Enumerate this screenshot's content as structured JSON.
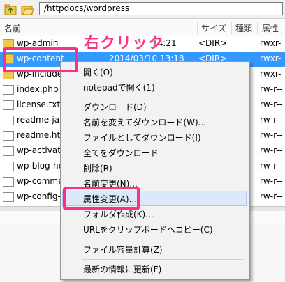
{
  "address_bar": {
    "path": "/httpdocs/wordpress"
  },
  "columns": {
    "name": "名前",
    "size": "サイズ",
    "type": "種類",
    "attr": "属性"
  },
  "rows": [
    {
      "name": "wp-admin",
      "date": "14:21",
      "size": "<DIR>",
      "attr": "rwxr-",
      "kind": "folder"
    },
    {
      "name": "wp-content",
      "date": "2014/03/10 13:18",
      "size": "<DIR>",
      "attr": "rwxr-",
      "kind": "folder",
      "selected": true
    },
    {
      "name": "wp-include",
      "date": "",
      "size": "",
      "attr": "rwxr-",
      "kind": "folder"
    },
    {
      "name": "index.php",
      "date": "",
      "size": "",
      "attr": "rw-r--",
      "kind": "file"
    },
    {
      "name": "license.txt",
      "date": "",
      "size": "",
      "attr": "rw-r--",
      "kind": "file"
    },
    {
      "name": "readme-ja",
      "date": "",
      "size": "",
      "attr": "rw-r--",
      "kind": "file"
    },
    {
      "name": "readme.ht",
      "date": "",
      "size": "",
      "attr": "rw-r--",
      "kind": "file"
    },
    {
      "name": "wp-activat",
      "date": "",
      "size": "",
      "attr": "rw-r--",
      "kind": "file"
    },
    {
      "name": "wp-blog-he",
      "date": "",
      "size": "",
      "attr": "rw-r--",
      "kind": "file"
    },
    {
      "name": "wp-comme",
      "date": "",
      "size": "",
      "attr": "rw-r--",
      "kind": "file"
    },
    {
      "name": "wp-config-",
      "date": "",
      "size": "",
      "attr": "rw-r--",
      "kind": "file"
    }
  ],
  "context_menu": {
    "items": [
      {
        "label": "開く(O)"
      },
      {
        "label": "notepadで開く(1)"
      },
      {
        "label": "ダウンロード(D)"
      },
      {
        "label": "名前を変えてダウンロード(W)..."
      },
      {
        "label": "ファイルとしてダウンロード(I)"
      },
      {
        "label": "全てをダウンロード"
      },
      {
        "label": "削除(R)"
      },
      {
        "label": "名前変更(N)..."
      },
      {
        "label": "属性変更(A)...",
        "highlighted": true
      },
      {
        "label": "フォルダ作成(K)..."
      },
      {
        "label": "URLをクリップボードへコピー(C)"
      },
      {
        "label": "ファイル容量計算(Z)"
      },
      {
        "label": "最新の情報に更新(F)"
      }
    ]
  },
  "annotation": {
    "text": "右クリック",
    "color": "#ff2f86"
  },
  "colors": {
    "selection": "#3399ff",
    "annotation": "#ff2f86",
    "menu_hover": "#dbe9f8"
  }
}
